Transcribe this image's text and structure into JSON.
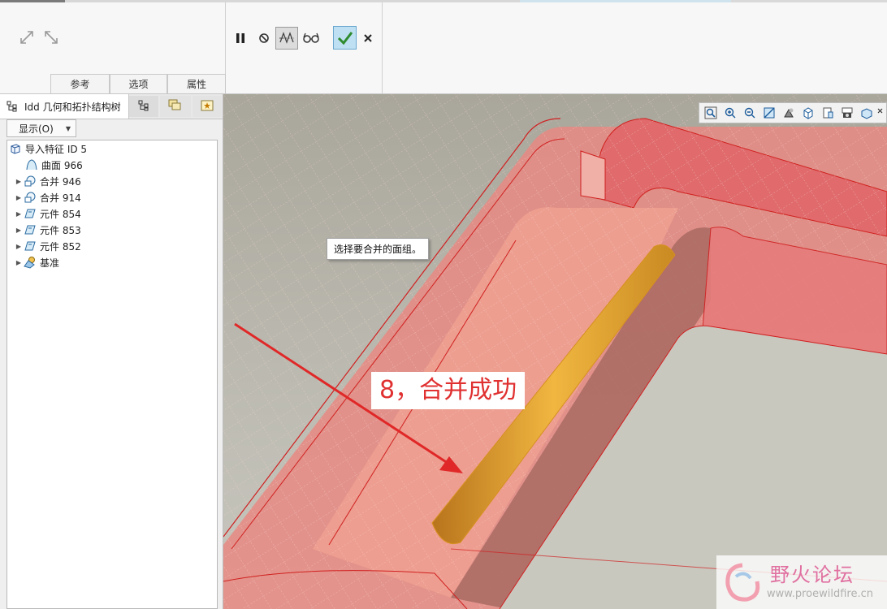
{
  "ribbon": {
    "tabs": [
      {
        "label": "参考"
      },
      {
        "label": "选项"
      },
      {
        "label": "属性"
      }
    ],
    "tools": {
      "pause": "pause-icon",
      "stop": "stop-icon",
      "preview": "preview-icon",
      "glasses": "glasses-icon",
      "ok": "check-icon",
      "cancel": "close-icon"
    }
  },
  "panel": {
    "tree_tab_label": "Idd 几何和拓扑结构树",
    "display_button": "显示(O)",
    "tree": [
      {
        "label": "导入特征 ID 5",
        "expandable": false,
        "indent": 0,
        "icon": "import-feature-icon"
      },
      {
        "label": "曲面 966",
        "expandable": false,
        "indent": 1,
        "icon": "surface-icon"
      },
      {
        "label": "合并 946",
        "expandable": true,
        "indent": 1,
        "icon": "merge-icon"
      },
      {
        "label": "合并 914",
        "expandable": true,
        "indent": 1,
        "icon": "merge-icon"
      },
      {
        "label": "元件 854",
        "expandable": true,
        "indent": 1,
        "icon": "component-icon"
      },
      {
        "label": "元件 853",
        "expandable": true,
        "indent": 1,
        "icon": "component-icon"
      },
      {
        "label": "元件 852",
        "expandable": true,
        "indent": 1,
        "icon": "component-icon"
      },
      {
        "label": "基准",
        "expandable": true,
        "indent": 1,
        "icon": "datum-icon"
      }
    ]
  },
  "viewport": {
    "tooltip": "选择要合并的面组。",
    "annotation": "8，合并成功",
    "watermark": {
      "title": "野火论坛",
      "url": "www.proewildfire.cn"
    }
  },
  "colors": {
    "accent_ok": "#2e8b2e",
    "annotation": "#e03030",
    "model": "#e8706f",
    "highlight": "#e8a030"
  }
}
